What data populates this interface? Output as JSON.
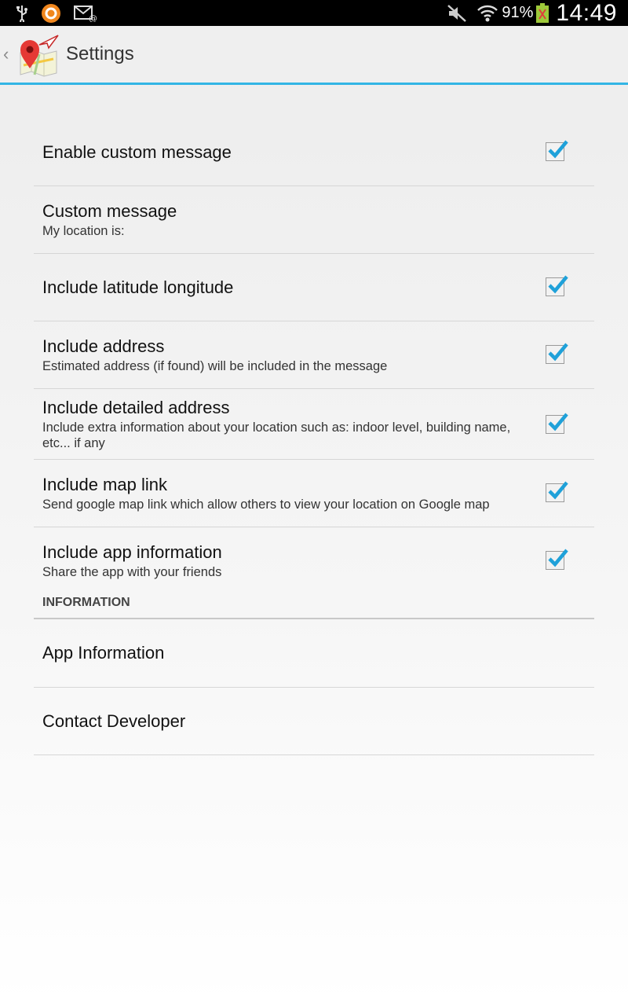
{
  "status_bar": {
    "icons": [
      "usb-icon",
      "avast-icon",
      "email-icon",
      "mute-icon",
      "wifi-icon",
      "battery-icon"
    ],
    "battery_percent": "91%",
    "time": "14:49"
  },
  "action_bar": {
    "title": "Settings",
    "accent_color": "#33b5e5"
  },
  "preferences": [
    {
      "title": "Enable custom message",
      "summary": "",
      "checked": true
    },
    {
      "title": "Custom message",
      "summary": "My location is:",
      "checked": null
    },
    {
      "title": "Include latitude longitude",
      "summary": "",
      "checked": true
    },
    {
      "title": "Include address",
      "summary": "Estimated address (if found) will be included in the message",
      "checked": true
    },
    {
      "title": "Include detailed address",
      "summary": "Include extra information about your location such as: indoor level, building name, etc... if any",
      "checked": true
    },
    {
      "title": "Include map link",
      "summary": "Send google map link which allow others to view your location on Google map",
      "checked": true
    },
    {
      "title": "Include app information",
      "summary": "Share the app with your friends",
      "checked": true
    }
  ],
  "information_section": {
    "header": "INFORMATION",
    "items": [
      {
        "title": "App Information"
      },
      {
        "title": "Contact Developer"
      }
    ]
  }
}
